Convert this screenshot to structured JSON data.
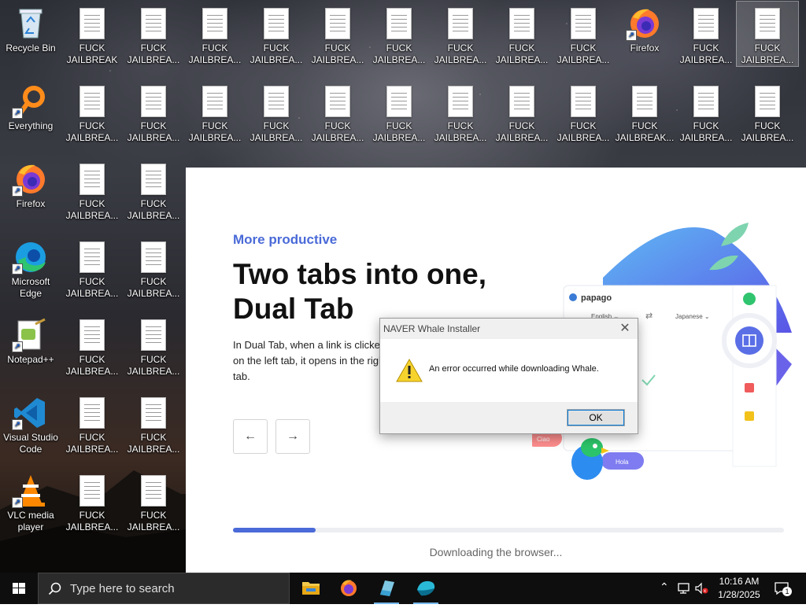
{
  "desktop": {
    "icons": [
      {
        "label": "Recycle Bin",
        "type": "recycle"
      },
      {
        "label": "FUCK\nJAILBREAK",
        "type": "doc"
      },
      {
        "label": "FUCK\nJAILBREA...",
        "type": "doc"
      },
      {
        "label": "FUCK\nJAILBREA...",
        "type": "doc"
      },
      {
        "label": "FUCK\nJAILBREA...",
        "type": "doc"
      },
      {
        "label": "FUCK\nJAILBREA...",
        "type": "doc"
      },
      {
        "label": "FUCK\nJAILBREA...",
        "type": "doc"
      },
      {
        "label": "FUCK\nJAILBREA...",
        "type": "doc"
      },
      {
        "label": "FUCK\nJAILBREA...",
        "type": "doc"
      },
      {
        "label": "FUCK\nJAILBREA...",
        "type": "doc"
      },
      {
        "label": "Firefox",
        "type": "firefox"
      },
      {
        "label": "FUCK\nJAILBREA...",
        "type": "doc"
      },
      {
        "label": "FUCK\nJAILBREA...",
        "type": "doc"
      },
      {
        "label": "Everything",
        "type": "everything"
      },
      {
        "label": "FUCK\nJAILBREA...",
        "type": "doc"
      },
      {
        "label": "FUCK\nJAILBREA...",
        "type": "doc"
      },
      {
        "label": "FUCK\nJAILBREA...",
        "type": "doc"
      },
      {
        "label": "FUCK\nJAILBREA...",
        "type": "doc"
      },
      {
        "label": "FUCK\nJAILBREA...",
        "type": "doc"
      },
      {
        "label": "FUCK\nJAILBREA...",
        "type": "doc"
      },
      {
        "label": "FUCK\nJAILBREA...",
        "type": "doc"
      },
      {
        "label": "FUCK\nJAILBREA...",
        "type": "doc"
      },
      {
        "label": "FUCK\nJAILBREA...",
        "type": "doc"
      },
      {
        "label": "FUCK\nJAILBREAK...",
        "type": "doc"
      },
      {
        "label": "FUCK\nJAILBREA...",
        "type": "doc"
      },
      {
        "label": "FUCK\nJAILBREA...",
        "type": "doc"
      },
      {
        "label": "Firefox",
        "type": "firefox"
      },
      {
        "label": "FUCK\nJAILBREA...",
        "type": "doc"
      },
      {
        "label": "FUCK\nJAILBREA...",
        "type": "doc"
      },
      {
        "label": "Microsoft\nEdge",
        "type": "edge"
      },
      {
        "label": "FUCK\nJAILBREA...",
        "type": "doc"
      },
      {
        "label": "FUCK\nJAILBREA...",
        "type": "doc"
      },
      {
        "label": "Notepad++",
        "type": "notepad"
      },
      {
        "label": "FUCK\nJAILBREA...",
        "type": "doc"
      },
      {
        "label": "FUCK\nJAILBREA...",
        "type": "doc"
      },
      {
        "label": "Visual Studio\nCode",
        "type": "vscode"
      },
      {
        "label": "FUCK\nJAILBREA...",
        "type": "doc"
      },
      {
        "label": "FUCK\nJAILBREA...",
        "type": "doc"
      },
      {
        "label": "VLC media\nplayer",
        "type": "vlc"
      },
      {
        "label": "FUCK\nJAILBREA...",
        "type": "doc"
      },
      {
        "label": "FUCK\nJAILBREA...",
        "type": "doc"
      }
    ]
  },
  "installer": {
    "tagline": "More productive",
    "title": "Two tabs into one, Dual Tab",
    "description": "In Dual Tab, when a link is clicked on the left tab, it opens in the right tab.",
    "prev_icon": "←",
    "next_icon": "→",
    "progress": 0.15,
    "status": "Downloading the browser...",
    "illustration": {
      "app_name": "papago",
      "lang_from": "English ⌄",
      "lang_to": "Japanese ⌄",
      "swap": "⇄",
      "bubble1": "Ciao",
      "bubble2": "Hola"
    }
  },
  "dialog": {
    "title": "NAVER Whale Installer",
    "close": "✕",
    "message": "An error occurred while downloading Whale.",
    "ok_label": "OK"
  },
  "taskbar": {
    "search_placeholder": "Type here to search",
    "time": "10:16 AM",
    "date": "1/28/2025",
    "notification_count": "1"
  },
  "colors": {
    "accent": "#4a6ad8",
    "taskbar": "#0e0e0f"
  }
}
